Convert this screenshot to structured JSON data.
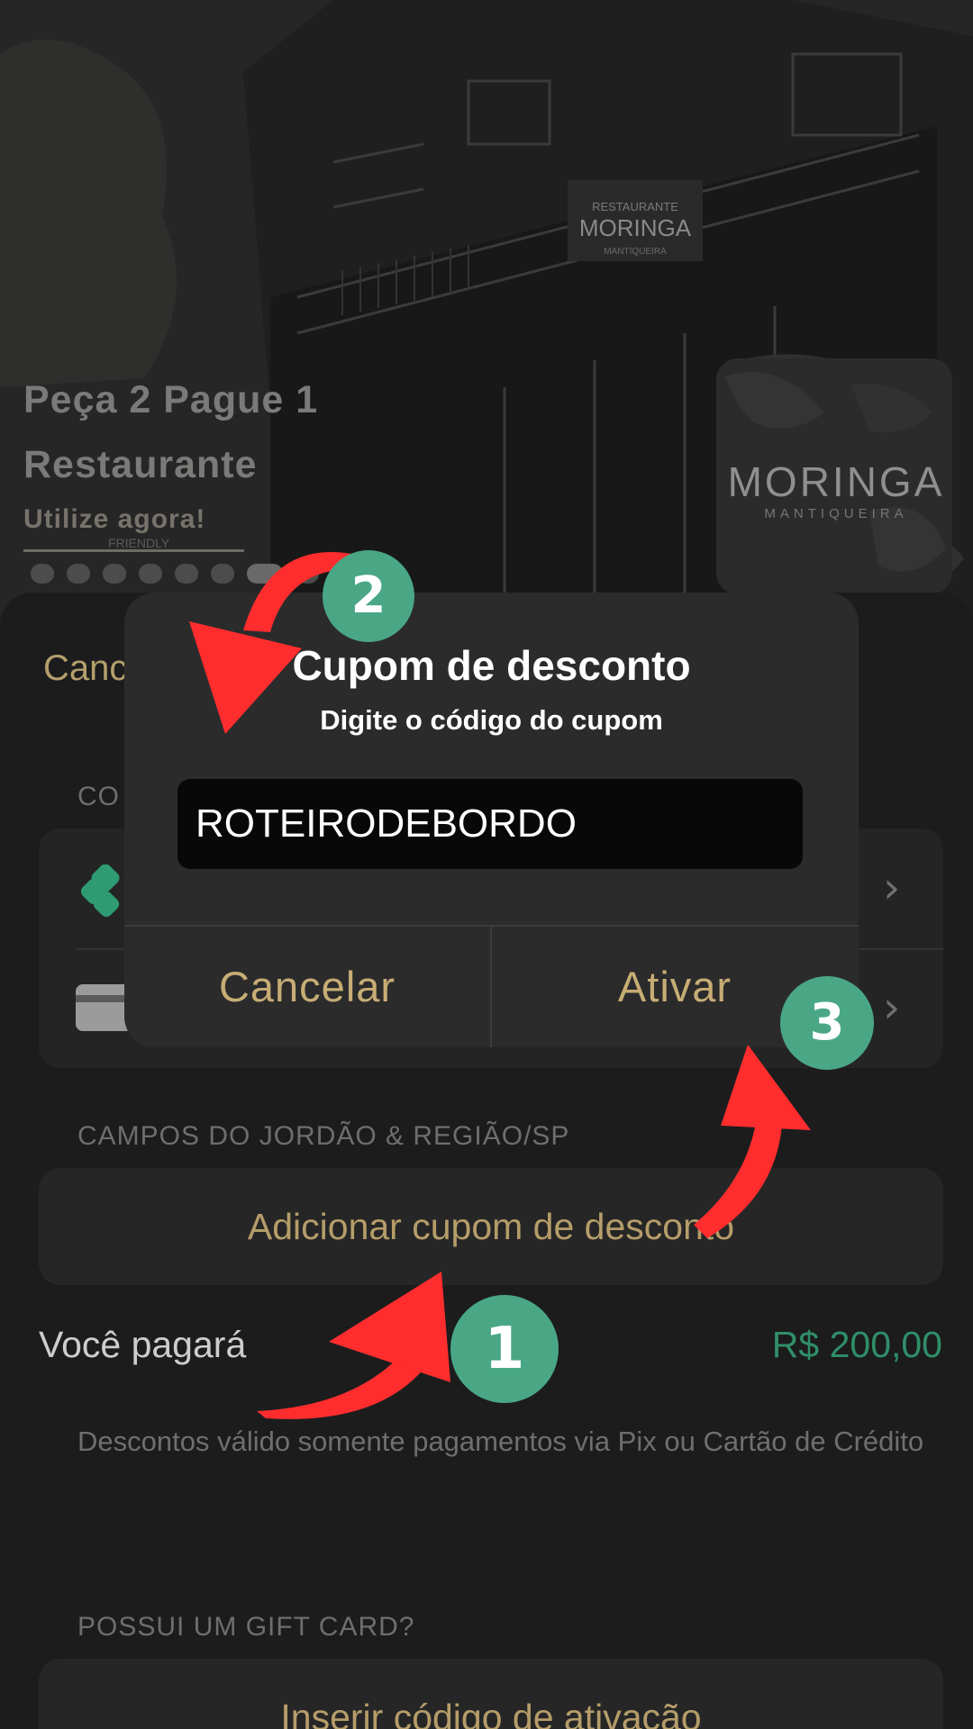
{
  "hero": {
    "title_line1": "Peça 2 Pague 1",
    "title_line2": "Restaurante",
    "cta": "Utilize agora!",
    "logo_text": "MORINGA",
    "logo_sub": "MANTIQUEIRA",
    "sign_line1": "RESTAURANTE",
    "sign_line2": "MORINGA",
    "sign_line3": "MANTIQUEIRA",
    "friendly_sign": "FRIENDLY",
    "carousel_count": 8,
    "carousel_active_index": 6
  },
  "sheet": {
    "cancel_label": "Canc",
    "payment_section_label": "CO",
    "location_label": "CAMPOS DO JORDÃO & REGIÃO/SP",
    "coupon_button": "Adicionar cupom de desconto",
    "total_label": "Você pagará",
    "total_value": "R$ 200,00",
    "note": "Descontos válido somente pagamentos via Pix ou Cartão de Crédito",
    "gift_label": "POSSUI UM GIFT CARD?",
    "gift_button": "Inserir código de ativação"
  },
  "dialog": {
    "title": "Cupom de desconto",
    "subtitle": "Digite o código do cupom",
    "input_value": "ROTEIRODEBORDO",
    "cancel_button": "Cancelar",
    "confirm_button": "Ativar"
  },
  "annotations": {
    "step1": "1",
    "step2": "2",
    "step3": "3",
    "badge_color": "#4aa786",
    "arrow_color": "#ff2d2d"
  },
  "colors": {
    "accent_gold": "#b59d69",
    "price_green": "#2f8f69"
  }
}
